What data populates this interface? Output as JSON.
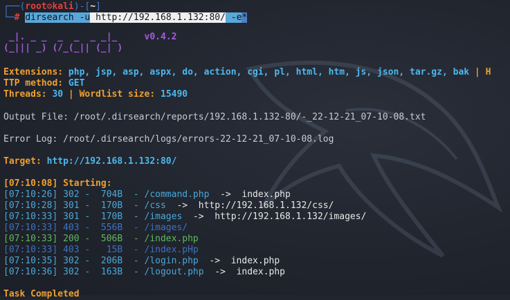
{
  "prompt": {
    "top_prefix": "┌──(",
    "user": "root",
    "at": "⚙",
    "host": "kali",
    "mid": ")-[",
    "dir": "~",
    "close": "]",
    "bottom_prefix": "└─",
    "hash": "#"
  },
  "command": {
    "program": "dirsearch",
    "flag_u": "-u",
    "url": "http://192.168.1.132:80/",
    "flag_e": "-e",
    "arg_e": "*"
  },
  "banner": {
    "line1": " _|. _ _  _  _  _ _|_",
    "line2": "(_||| _) (/_(_|| (_| )",
    "version": "v0.4.2"
  },
  "config": {
    "extensions_label": "Extensions:",
    "extensions_value": "php, jsp, asp, aspx, do, action, cgi, pl, html, htm, js, json, tar.gz, bak",
    "extensions_tail": " | H",
    "method_label": "TTP method:",
    "method_value": "GET",
    "threads_label": "Threads:",
    "threads_value": "30",
    "sep": " | ",
    "wordlist_label": "Wordlist size:",
    "wordlist_value": "15490"
  },
  "output_file": "Output File: /root/.dirsearch/reports/192.168.1.132-80/-_22-12-21_07-10-08.txt",
  "error_log": "Error Log: /root/.dirsearch/logs/errors-22-12-21_07-10-08.log",
  "target": {
    "label": "Target:",
    "value": "http://192.168.1.132:80/"
  },
  "starting": "[07:10:08] Starting:",
  "results": [
    {
      "time": "[07:10:26]",
      "code": "302",
      "size": " 704B",
      "path": "/command.php",
      "redirect": "index.php",
      "arrow": "->",
      "color": "cyan"
    },
    {
      "time": "[07:10:28]",
      "code": "301",
      "size": " 170B",
      "path": "/css",
      "redirect": "http://192.168.1.132/css/",
      "arrow": "->",
      "color": "cyan"
    },
    {
      "time": "[07:10:33]",
      "code": "301",
      "size": " 170B",
      "path": "/images",
      "redirect": "http://192.168.1.132/images/",
      "arrow": "->",
      "color": "cyan"
    },
    {
      "time": "[07:10:33]",
      "code": "403",
      "size": " 556B",
      "path": "/images/",
      "redirect": "",
      "arrow": "",
      "color": "blue"
    },
    {
      "time": "[07:10:33]",
      "code": "200",
      "size": " 506B",
      "path": "/index.php",
      "redirect": "",
      "arrow": "",
      "color": "green"
    },
    {
      "time": "[07:10:33]",
      "code": "403",
      "size": "  15B",
      "path": "/index.pHp",
      "redirect": "",
      "arrow": "",
      "color": "blue"
    },
    {
      "time": "[07:10:35]",
      "code": "302",
      "size": " 206B",
      "path": "/login.php",
      "redirect": "index.php",
      "arrow": "->",
      "color": "cyan"
    },
    {
      "time": "[07:10:36]",
      "code": "302",
      "size": " 163B",
      "path": "/logout.php",
      "redirect": "index.php",
      "arrow": "->",
      "color": "cyan"
    }
  ],
  "task_completed": "Task Completed"
}
